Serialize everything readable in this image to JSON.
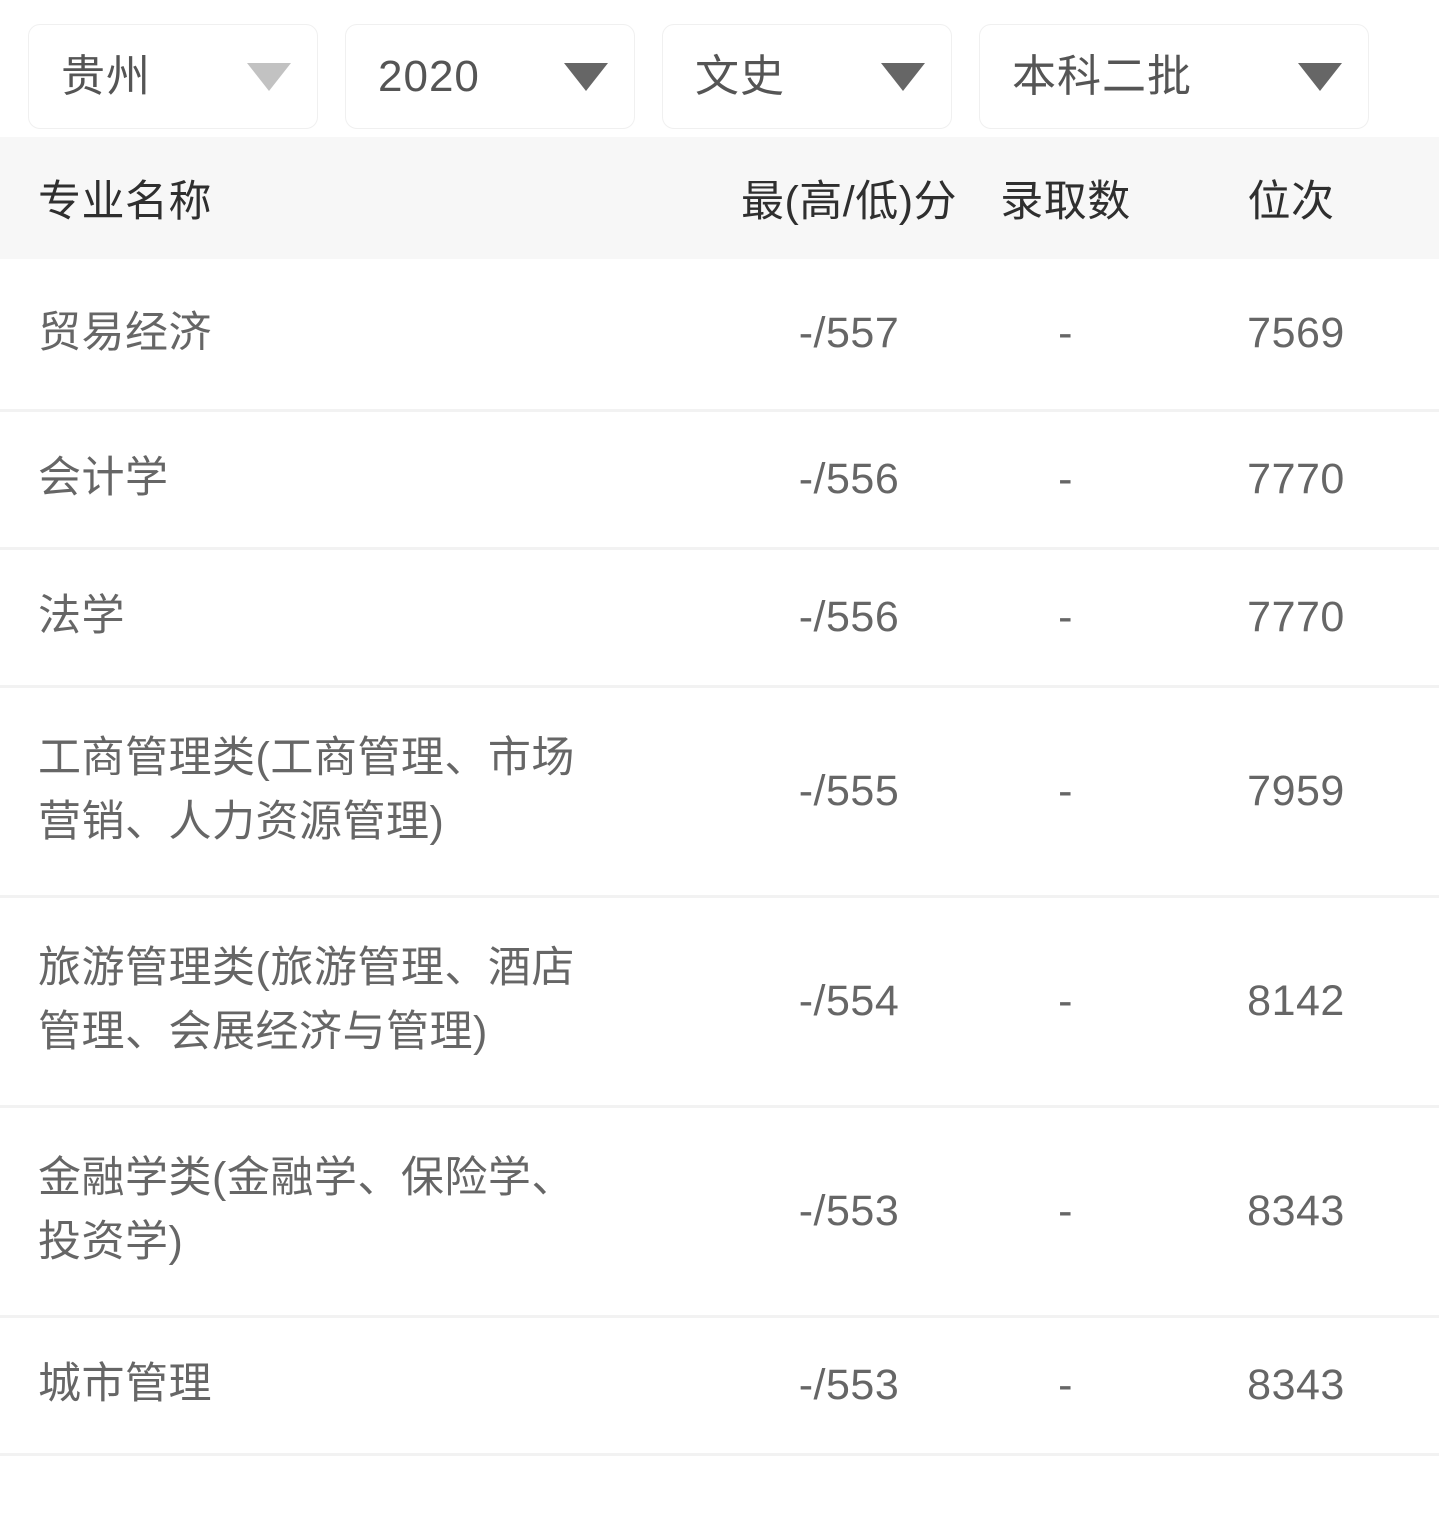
{
  "filters": [
    {
      "name": "province",
      "value": "贵州",
      "caret": "chevron-down-icon",
      "caret_muted": true
    },
    {
      "name": "year",
      "value": "2020",
      "caret": "chevron-down-icon",
      "caret_muted": false
    },
    {
      "name": "subject",
      "value": "文史",
      "caret": "chevron-down-icon",
      "caret_muted": false
    },
    {
      "name": "batch",
      "value": "本科二批",
      "caret": "chevron-down-icon",
      "caret_muted": false
    }
  ],
  "table": {
    "columns": [
      {
        "key": "major",
        "label": "专业名称"
      },
      {
        "key": "score",
        "label": "最(高/低)分"
      },
      {
        "key": "admitted",
        "label": "录取数"
      },
      {
        "key": "rank",
        "label": "位次"
      }
    ],
    "rows": [
      {
        "major": "贸易经济",
        "score": "-/557",
        "admitted": "-",
        "rank": "7569"
      },
      {
        "major": "会计学",
        "score": "-/556",
        "admitted": "-",
        "rank": "7770"
      },
      {
        "major": "法学",
        "score": "-/556",
        "admitted": "-",
        "rank": "7770"
      },
      {
        "major": "工商管理类(工商管理、市场营销、人力资源管理)",
        "score": "-/555",
        "admitted": "-",
        "rank": "7959"
      },
      {
        "major": "旅游管理类(旅游管理、酒店管理、会展经济与管理)",
        "score": "-/554",
        "admitted": "-",
        "rank": "8142"
      },
      {
        "major": "金融学类(金融学、保险学、投资学)",
        "score": "-/553",
        "admitted": "-",
        "rank": "8343"
      },
      {
        "major": "城市管理",
        "score": "-/553",
        "admitted": "-",
        "rank": "8343"
      }
    ]
  },
  "colors": {
    "page_background": "#ffffff",
    "header_band": "#f7f7f7",
    "header_text": "#2f2f2f",
    "body_text": "#666666",
    "divider": "#f2f2f2",
    "select_border": "#f0f0f0",
    "caret_active": "#666666",
    "caret_muted": "#c2c2c2"
  }
}
